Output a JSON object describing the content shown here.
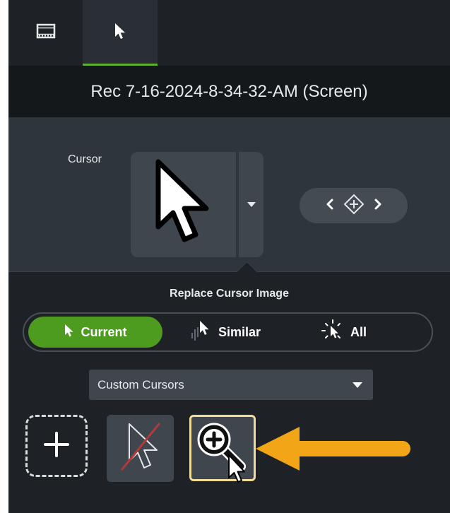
{
  "tabs": [
    {
      "icon": "film-icon",
      "active": false
    },
    {
      "icon": "cursor-arrow-icon",
      "active": true
    }
  ],
  "clip_title": "Rec 7-16-2024-8-34-32-AM (Screen)",
  "properties": {
    "cursor_label": "Cursor"
  },
  "replace": {
    "heading": "Replace Cursor Image",
    "scope_options": [
      {
        "label": "Current",
        "selected": true
      },
      {
        "label": "Similar",
        "selected": false
      },
      {
        "label": "All",
        "selected": false
      }
    ],
    "cursor_set": "Custom Cursors",
    "cursor_items": [
      {
        "name": "add-custom-cursor",
        "icon": "plus-icon"
      },
      {
        "name": "no-cursor",
        "icon": "hidden-cursor-icon"
      },
      {
        "name": "zoom-in-cursor",
        "icon": "magnifier-plus-icon",
        "selected": true
      }
    ]
  },
  "colors": {
    "accent_green": "#4d9b1f",
    "highlight_border": "#f1dc9a",
    "callout_arrow": "#f2a516"
  }
}
